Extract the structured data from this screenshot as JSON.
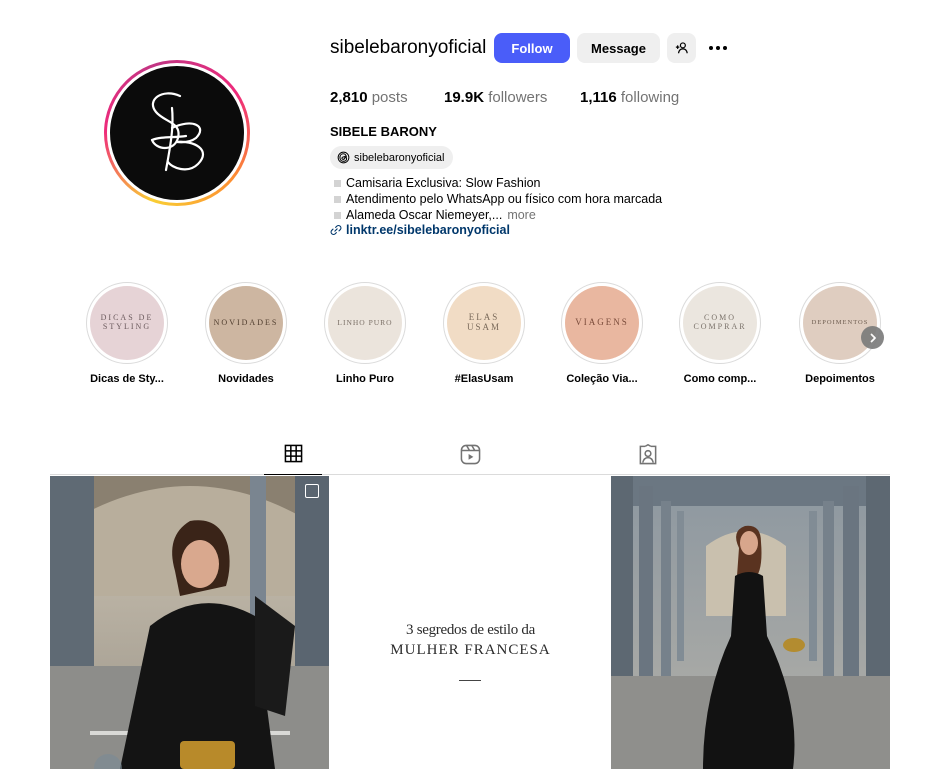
{
  "profile": {
    "username": "sibelebaronyoficial",
    "full_name": "SIBELE BARONY",
    "avatar_monogram": "SB",
    "follow_label": "Follow",
    "message_label": "Message",
    "stats": {
      "posts_count": "2,810",
      "posts_label": "posts",
      "followers_count": "19.9K",
      "followers_label": "followers",
      "following_count": "1,116",
      "following_label": "following"
    },
    "threads_handle": "sibelebaronyoficial",
    "bio": [
      "Camisaria Exclusiva: Slow Fashion",
      "Atendimento pelo WhatsApp ou físico com hora marcada",
      "Alameda Oscar Niemeyer,..."
    ],
    "bio_more": "more",
    "link": "linktr.ee/sibelebaronyoficial"
  },
  "highlights": [
    {
      "cover": "DICAS DE STYLING",
      "label": "Dicas de Sty...",
      "bg": "#e6d3d6",
      "fg": "#6b5a5d"
    },
    {
      "cover": "NOVIDADES",
      "label": "Novidades",
      "bg": "#cdb6a1",
      "fg": "#5a4636"
    },
    {
      "cover": "LINHO PURO",
      "label": "Linho Puro",
      "bg": "#ebe4dc",
      "fg": "#7a6f66"
    },
    {
      "cover": "ELAS USAM",
      "label": "#ElasUsam",
      "bg": "#f1dcc5",
      "fg": "#7a6a5a"
    },
    {
      "cover": "VIAGENS",
      "label": "Coleção Via...",
      "bg": "#e9b7a0",
      "fg": "#7a4b3a"
    },
    {
      "cover": "COMO COMPRAR",
      "label": "Como comp...",
      "bg": "#ebe6df",
      "fg": "#7a726a"
    },
    {
      "cover": "DEPOIMENTOS",
      "label": "Depoimentos",
      "bg": "#dfcdc0",
      "fg": "#6e5d50"
    }
  ],
  "tabs": [
    "grid-icon",
    "reels-icon",
    "tagged-icon"
  ],
  "posts": [
    {
      "kind": "photo"
    },
    {
      "kind": "text",
      "line1": "3 segredos de estilo da",
      "line2": "MULHER FRANCESA"
    },
    {
      "kind": "photo"
    }
  ],
  "colors": {
    "accent": "#4a5df9",
    "link": "#00376b",
    "muted": "#737373"
  }
}
